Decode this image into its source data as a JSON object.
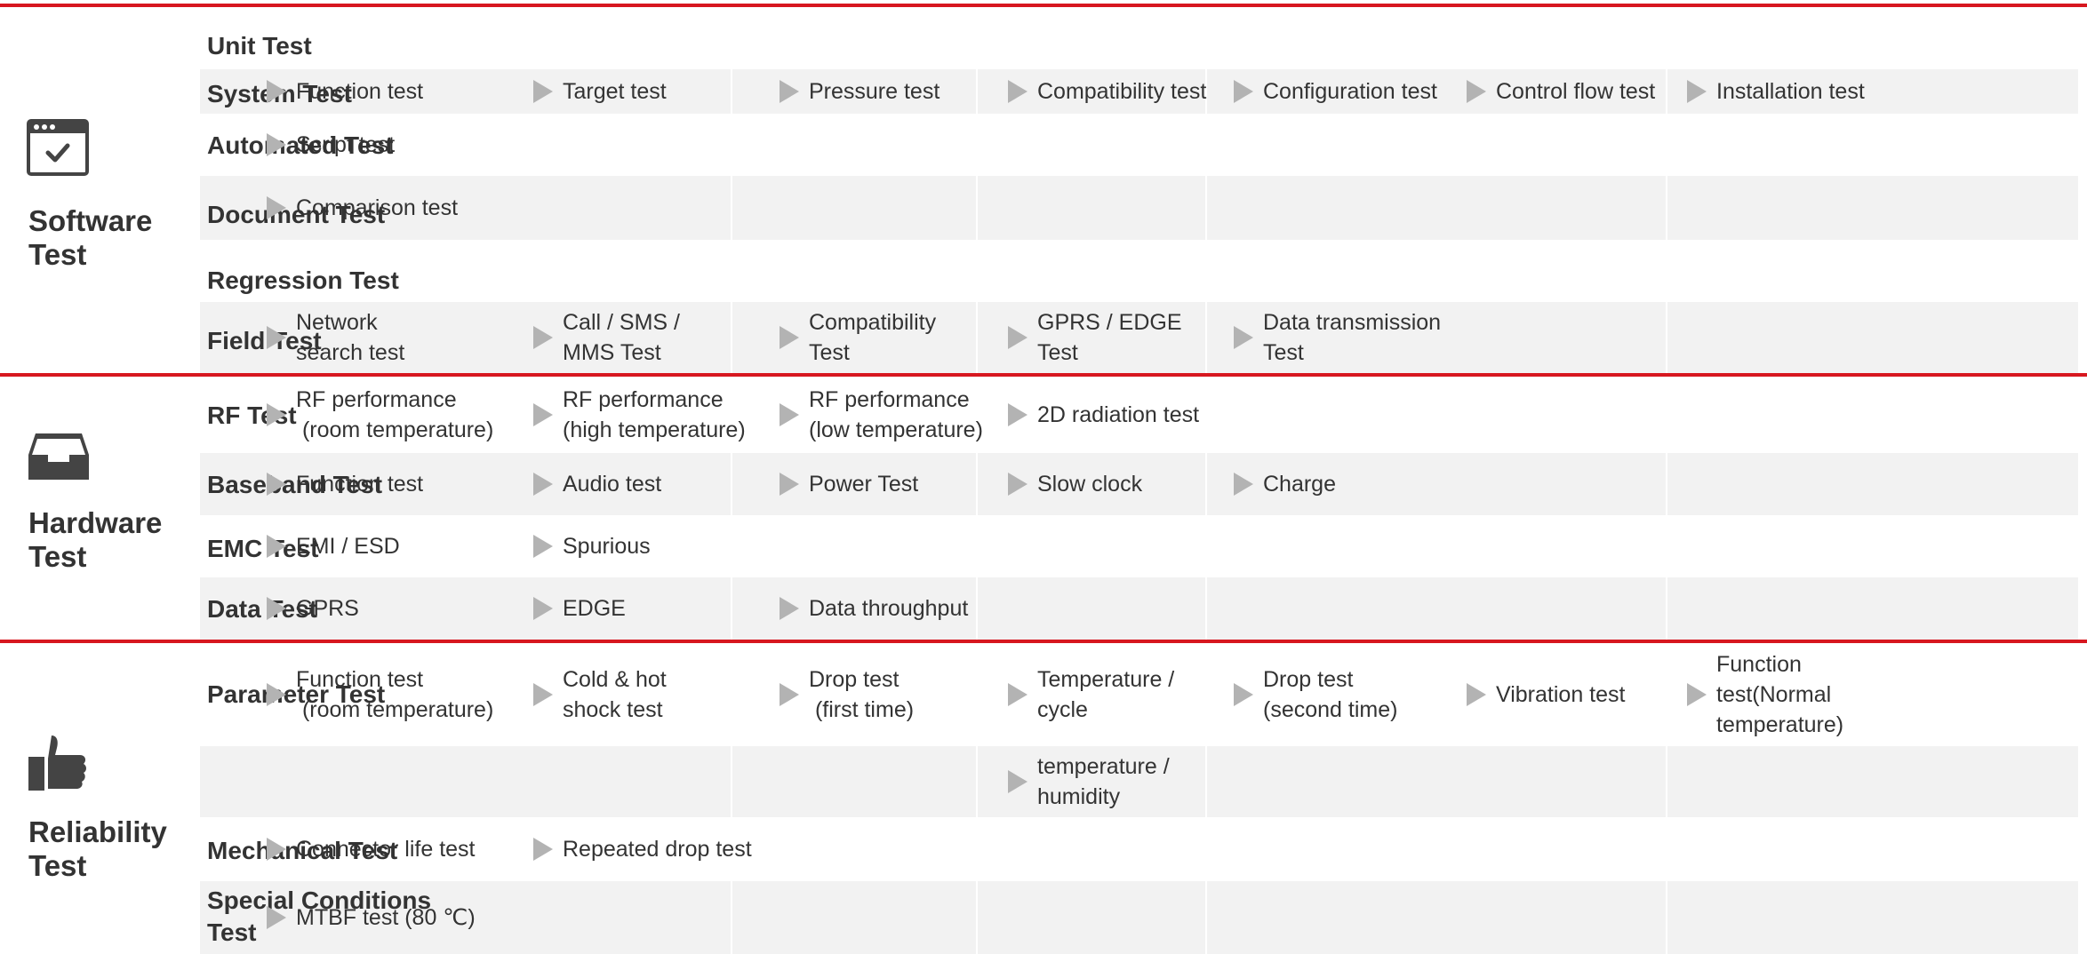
{
  "sections": [
    {
      "title": "Software\nTest",
      "icon": "browser-check-icon"
    },
    {
      "title": "Hardware\n Test",
      "icon": "inbox-tray-icon"
    },
    {
      "title": "Reliability\nTest",
      "icon": "thumbs-up-icon"
    }
  ],
  "rows": [
    {
      "label": "Unit Test",
      "cells": []
    },
    {
      "label": "System Test",
      "cells": [
        "Function test",
        "Target test",
        "Pressure test",
        "Compatibility test",
        "Configuration test",
        "Control flow test",
        "Installation test"
      ]
    },
    {
      "label": "Automated Test",
      "cells": [
        "Script test"
      ]
    },
    {
      "label": "Document Test",
      "cells": [
        "Comparison test"
      ]
    },
    {
      "label": "Regression Test",
      "cells": []
    },
    {
      "label": "Field Test",
      "cells": [
        "Network\nsearch test",
        "Call / SMS /\nMMS Test",
        "Compatibility\nTest",
        "GPRS / EDGE\nTest",
        "Data transmission\nTest"
      ]
    },
    {
      "label": "RF Test",
      "cells": [
        "RF performance\n (room temperature)",
        "RF performance\n(high temperature)",
        "RF performance\n(low temperature)",
        "2D radiation test"
      ]
    },
    {
      "label": "Baseband Test",
      "cells": [
        "Function test",
        "Audio test",
        "Power Test",
        "Slow clock",
        "Charge"
      ]
    },
    {
      "label": "EMC Test",
      "cells": [
        "EMI / ESD",
        "Spurious"
      ]
    },
    {
      "label": "Data Test",
      "cells": [
        "GPRS",
        "EDGE",
        "Data throughput"
      ]
    },
    {
      "label": "Parameter Test",
      "cells": [
        "Function test\n (room temperature)",
        "Cold & hot\nshock test",
        "Drop test\n (first time)",
        "Temperature /\ncycle",
        "Drop test\n(second time)",
        "Vibration test",
        "Function\ntest(Normal\ntemperature)"
      ]
    },
    {
      "label": "",
      "cells": [
        "",
        "",
        "",
        "temperature /\nhumidity"
      ]
    },
    {
      "label": "Mechanical Test",
      "cells": [
        "Connector life test",
        "Repeated drop test"
      ]
    },
    {
      "label": "Special Conditions\nTest",
      "cells": [
        "MTBF test (80 ℃)"
      ]
    }
  ]
}
